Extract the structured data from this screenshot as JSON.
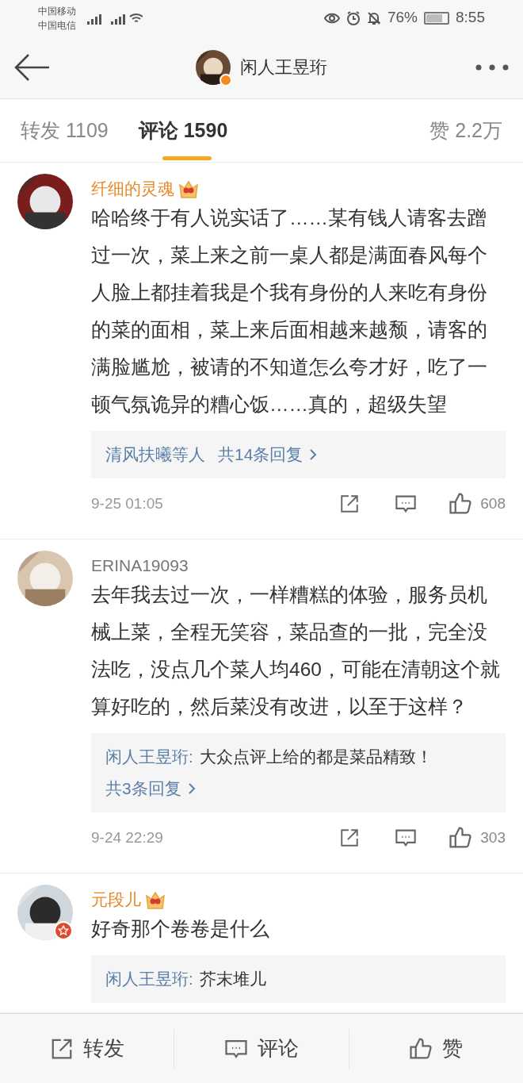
{
  "status_bar": {
    "carriers": [
      "中国移动",
      "中国电信"
    ],
    "battery": "76%",
    "time": "8:55"
  },
  "header": {
    "title": "闲人王昱珩",
    "verified": true
  },
  "tabs": [
    {
      "label": "转发 1109",
      "selected": false
    },
    {
      "label": "评论 1590",
      "selected": true
    },
    {
      "label": "赞 2.2万",
      "selected": false
    }
  ],
  "comments": [
    {
      "user": "纤细的灵魂",
      "vip": true,
      "verified": false,
      "text": "哈哈终于有人说实话了……某有钱人请客去蹭过一次，菜上来之前一桌人都是满面春风每个人脸上都挂着我是个我有身份的人来吃有身份的菜的面相，菜上来后面相越来越颓，请客的满脸尴尬，被请的不知道怎么夸才好，吃了一顿气氛诡异的糟心饭……真的，超级失望",
      "replies": {
        "kind": "summary",
        "names": "清风扶曦等人",
        "more": "共14条回复"
      },
      "time": "9-25 01:05",
      "likes": "608"
    },
    {
      "user": "ERINA19093",
      "vip": false,
      "verified": false,
      "text": "去年我去过一次，一样糟糕的体验，服务员机械上菜，全程无笑容，菜品查的一批，完全没法吃，没点几个菜人均460，可能在清朝这个就算好吃的，然后菜没有改进，以至于这样？",
      "replies": {
        "kind": "quote",
        "author": "闲人王昱珩:",
        "text": "大众点评上给的都是菜品精致！",
        "more": "共3条回复"
      },
      "time": "9-24 22:29",
      "likes": "303"
    },
    {
      "user": "元段儿",
      "vip": true,
      "verified": true,
      "text": "好奇那个卷卷是什么",
      "replies": {
        "kind": "quote",
        "author": "闲人王昱珩:",
        "text": "芥末堆儿"
      }
    }
  ],
  "bottom_bar": [
    {
      "kind": "repost",
      "label": "转发"
    },
    {
      "kind": "comment",
      "label": "评论"
    },
    {
      "kind": "like",
      "label": "赞"
    }
  ]
}
